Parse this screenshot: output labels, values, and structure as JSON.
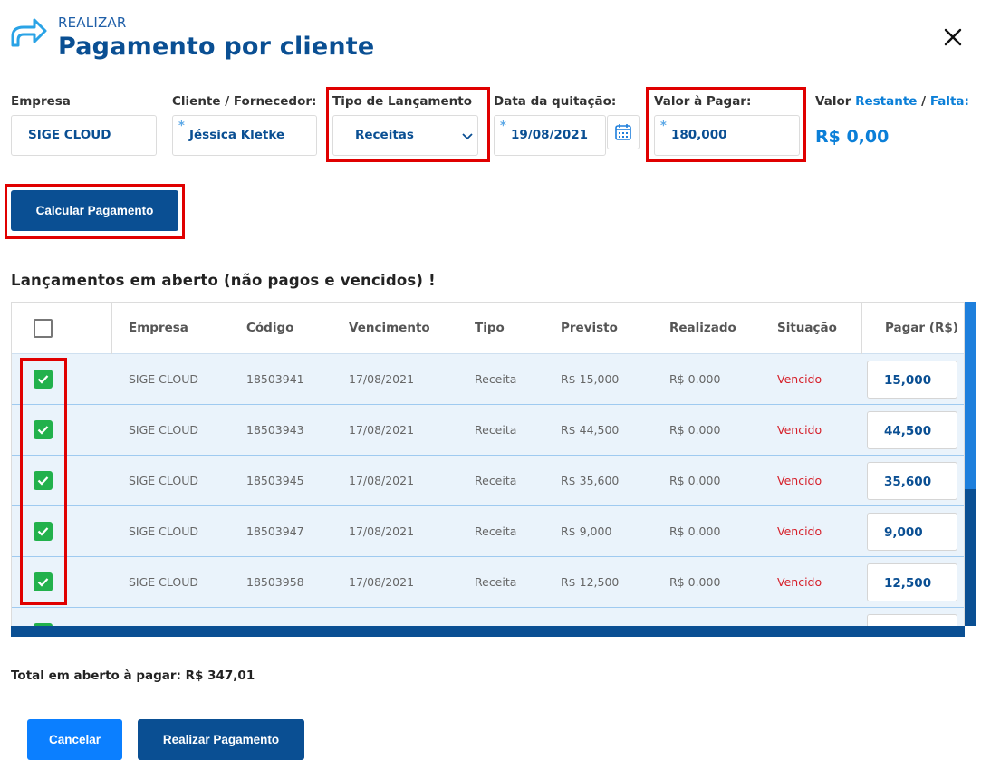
{
  "header": {
    "subtitle": "REALIZAR",
    "title": "Pagamento por cliente"
  },
  "form": {
    "empresa_label": "Empresa",
    "empresa_value": "SIGE CLOUD",
    "cliente_label": "Cliente / Fornecedor:",
    "cliente_value": "Jéssica Kletke",
    "tipo_label": "Tipo de Lançamento",
    "tipo_value": "Receitas",
    "data_label": "Data da quitação:",
    "data_value": "19/08/2021",
    "valor_pagar_label": "Valor à Pagar:",
    "valor_pagar_value": "180,000",
    "valor_label_prefix": "Valor",
    "valor_label_restante": "Restante",
    "valor_label_sep": "/",
    "valor_label_falta": "Falta:",
    "valor_result": "R$ 0,00",
    "required_mark": "*"
  },
  "actions": {
    "calc_label": "Calcular Pagamento",
    "cancel_label": "Cancelar",
    "pay_label": "Realizar Pagamento"
  },
  "section_title": "Lançamentos em aberto (não pagos e vencidos) !",
  "table": {
    "columns": [
      "Empresa",
      "Código",
      "Vencimento",
      "Tipo",
      "Previsto",
      "Realizado",
      "Situação",
      "Pagar (R$)"
    ],
    "rows": [
      {
        "empresa": "SIGE CLOUD",
        "codigo": "18503941",
        "vencimento": "17/08/2021",
        "tipo": "Receita",
        "previsto": "R$ 15,000",
        "realizado": "R$ 0.000",
        "situacao": "Vencido",
        "pagar": "15,000",
        "checked": true
      },
      {
        "empresa": "SIGE CLOUD",
        "codigo": "18503943",
        "vencimento": "17/08/2021",
        "tipo": "Receita",
        "previsto": "R$ 44,500",
        "realizado": "R$ 0.000",
        "situacao": "Vencido",
        "pagar": "44,500",
        "checked": true
      },
      {
        "empresa": "SIGE CLOUD",
        "codigo": "18503945",
        "vencimento": "17/08/2021",
        "tipo": "Receita",
        "previsto": "R$ 35,600",
        "realizado": "R$ 0.000",
        "situacao": "Vencido",
        "pagar": "35,600",
        "checked": true
      },
      {
        "empresa": "SIGE CLOUD",
        "codigo": "18503947",
        "vencimento": "17/08/2021",
        "tipo": "Receita",
        "previsto": "R$ 9,000",
        "realizado": "R$ 0.000",
        "situacao": "Vencido",
        "pagar": "9,000",
        "checked": true
      },
      {
        "empresa": "SIGE CLOUD",
        "codigo": "18503958",
        "vencimento": "17/08/2021",
        "tipo": "Receita",
        "previsto": "R$ 12,500",
        "realizado": "R$ 0.000",
        "situacao": "Vencido",
        "pagar": "12,500",
        "checked": true
      }
    ]
  },
  "total_label": "Total em aberto à pagar: R$ 347,01",
  "colors": {
    "primary": "#0a4f93",
    "accent": "#0b7fff",
    "success": "#22b14c",
    "danger": "#d6202a",
    "highlight": "#e00000"
  },
  "icons": [
    "share-arrow-icon",
    "close-icon",
    "chevron-down-icon",
    "calendar-icon",
    "checkbox-checked-icon"
  ]
}
